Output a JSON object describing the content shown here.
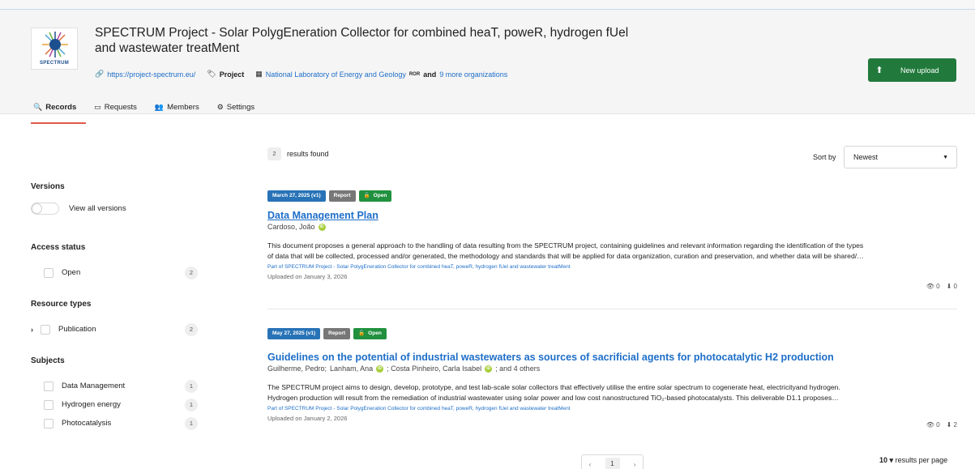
{
  "project": {
    "title_line1": "SPECTRUM Project - Solar PolygEneration Collector for combined heaT, poweR, hydrogen fUel",
    "title_line2": "and wastewater treatMent",
    "logo_text": "SPECTRUM",
    "url": "https://project-spectrum.eu/",
    "type": "Project",
    "org": "National Laboratory of Energy and Geology",
    "ror": "ROR",
    "and": "and",
    "more_orgs": "9 more organizations",
    "upload_label": "New upload"
  },
  "tabs": [
    {
      "label": "Records",
      "icon": "search-icon"
    },
    {
      "label": "Requests",
      "icon": "inbox-icon"
    },
    {
      "label": "Members",
      "icon": "users-icon"
    },
    {
      "label": "Settings",
      "icon": "cogs-icon"
    }
  ],
  "sidebar": {
    "versions_title": "Versions",
    "versions_toggle": "View all versions",
    "access_title": "Access status",
    "access_items": [
      {
        "label": "Open",
        "count": "2"
      }
    ],
    "resource_title": "Resource types",
    "resource_items": [
      {
        "label": "Publication",
        "count": "2"
      }
    ],
    "subjects_title": "Subjects",
    "subject_items": [
      {
        "label": "Data Management",
        "count": "1"
      },
      {
        "label": "Hydrogen energy",
        "count": "1"
      },
      {
        "label": "Photocatalysis",
        "count": "1"
      }
    ]
  },
  "results": {
    "count": "2",
    "found_label": "results found",
    "sort_label": "Sort by",
    "sort_value": "Newest",
    "items": [
      {
        "date": "March 27, 2025 (v1)",
        "type": "Report",
        "access": "Open",
        "title": "Data Management Plan",
        "authors": "Cardoso, João",
        "desc_line1": "This document proposes a general approach to the handling of data resulting from the SPECTRUM project, containing guidelines and relevant information regarding the identification of the types",
        "desc_line2": "of data that will be collected, processed and/or generated, the methodology and standards that will be applied for data organization, curation and preservation, and whether data will be shared/…",
        "part_of": "Part of SPECTRUM Project - Solar PolygEneration Collector for combined heaT, poweR, hydrogen fUel and wastewater treatMent",
        "uploaded": "Uploaded on January 3, 2026",
        "views": "0",
        "downloads": "0"
      },
      {
        "date": "May 27, 2025 (v1)",
        "type": "Report",
        "access": "Open",
        "title": "Guidelines on the potential of industrial wastewaters as sources of sacrificial agents for photocatalytic H2 production",
        "author1": "Guilherme, Pedro;",
        "author2": "Lanham, Ana",
        "author3": "; Costa Pinheiro, Carla Isabel",
        "author4": "; and 4 others",
        "desc_line1": "The SPECTRUM project aims to design, develop, prototype, and test lab-scale solar collectors that effectively utilise the entire solar spectrum to cogenerate heat, electricityand hydrogen.",
        "desc_line2": "Hydrogen production will result from the remediation of industrial wastewater using solar power and low cost nanostructured TiO₂-based photocatalysts. This deliverable D1.1 proposes…",
        "part_of": "Part of SPECTRUM Project - Solar PolygEneration Collector for combined heaT, poweR, hydrogen fUel and wastewater treatMent",
        "uploaded": "Uploaded on January 2, 2026",
        "views": "0",
        "downloads": "2"
      }
    ]
  },
  "pagination": {
    "prev": "‹",
    "page": "1",
    "next": "›",
    "per_page": "10",
    "per_page_label": "results per page"
  },
  "colors": {
    "brand_green": "#217a3c",
    "link_blue": "#1e6ec8",
    "date_label": "#2873b7",
    "type_label": "#777777",
    "open_label": "#21913f",
    "active_tab": "#e05a4a"
  }
}
